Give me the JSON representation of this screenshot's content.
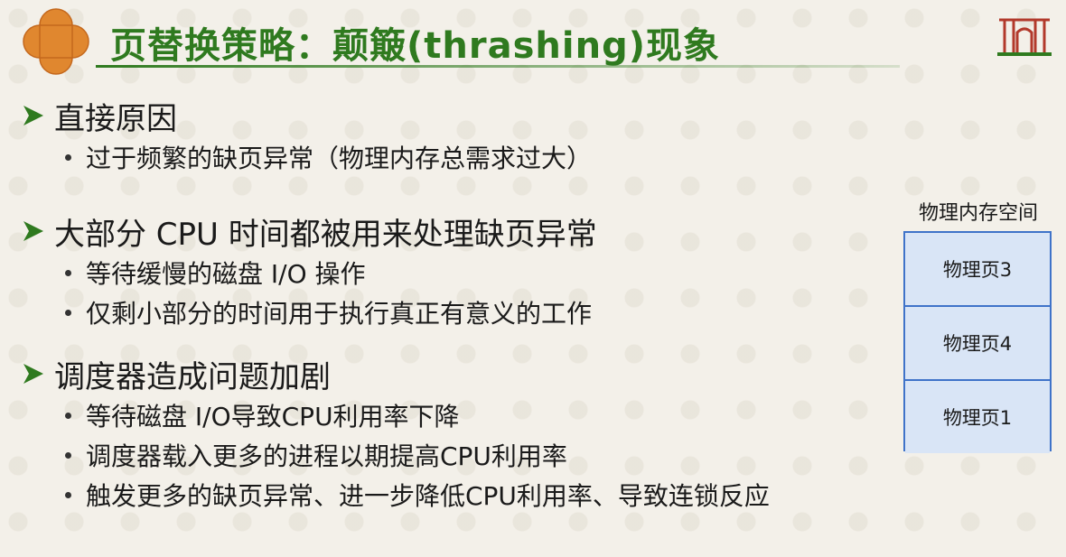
{
  "title": "页替换策略：颠簸(thrashing)现象",
  "sections": [
    {
      "heading": "直接原因",
      "bullets": [
        "过于频繁的缺页异常（物理内存总需求过大）"
      ]
    },
    {
      "heading": "大部分 CPU 时间都被用来处理缺页异常",
      "bullets": [
        "等待缓慢的磁盘 I/O 操作",
        "仅剩小部分的时间用于执行真正有意义的工作"
      ]
    },
    {
      "heading": "调度器造成问题加剧",
      "bullets": [
        "等待磁盘 I/O导致CPU利用率下降",
        "调度器载入更多的进程以期提高CPU利用率",
        "触发更多的缺页异常、进一步降低CPU利用率、导致连锁反应"
      ]
    }
  ],
  "memory": {
    "label": "物理内存空间",
    "pages": [
      "物理页3",
      "物理页4",
      "物理页1"
    ]
  },
  "colors": {
    "title": "#2f7a1f",
    "badge": "#e0872f",
    "memory_fill": "#d9e5f6",
    "memory_border": "#3f73c9",
    "corner_logo": "#b2392b"
  },
  "icons": {
    "badge": "quatrefoil-badge-icon",
    "bullet_arrow": "arrow-bullet-icon",
    "corner": "university-logo-icon"
  }
}
